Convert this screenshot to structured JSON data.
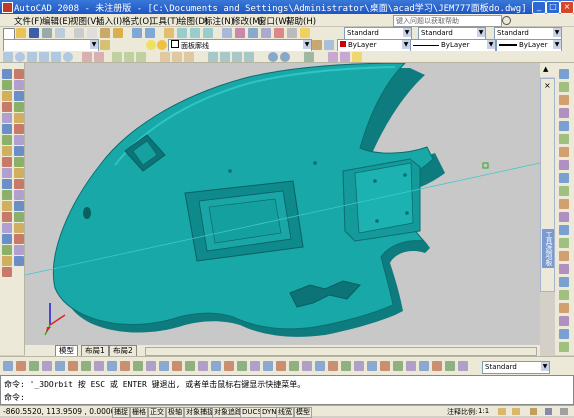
{
  "window": {
    "title": "AutoCAD 2008 - 未注册版 - [C:\\Documents and Settings\\Administrator\\桌面\\acad学习\\JEM777面板do.dwg]"
  },
  "menu": {
    "items": [
      "文件(F)",
      "编辑(E)",
      "视图(V)",
      "插入(I)",
      "格式(O)",
      "工具(T)",
      "绘图(D)",
      "标注(N)",
      "修改(M)",
      "窗口(W)",
      "帮助(H)"
    ],
    "search_placeholder": "键入问题以获取帮助"
  },
  "toolbars": {
    "style_combo1": "Standard",
    "style_combo2": "Standard",
    "style_combo3": "Standard",
    "layer_combo": "面板廓线",
    "color_combo": "ByLayer",
    "linetype_combo": "ByLayer",
    "lineweight_combo": "ByLayer",
    "bottom_combo": "Standard"
  },
  "palette": {
    "label": "工具选项板"
  },
  "tabs": [
    "模型",
    "布局1",
    "布局2"
  ],
  "command": {
    "line1": "命令: '_3DOrbit 按 ESC 或 ENTER 键退出, 或者单击鼠标右键显示快捷菜单。",
    "line2": "命令:"
  },
  "status": {
    "coords": "-860.5520, 113.9509 , 0.0000",
    "buttons": [
      "捕捉",
      "栅格",
      "正交",
      "极轴",
      "对象捕捉",
      "对象追踪",
      "DUCS",
      "DYN",
      "线宽",
      "模型"
    ],
    "annotation_scale_label": "注释比例:",
    "annotation_scale": "1:1"
  },
  "colors": {
    "model_fill": "#18a8a8",
    "model_dark": "#0e7c7e",
    "model_light": "#2fc4c4",
    "background": "#c8c8c8",
    "axis_line": "#40c8c8",
    "titlebar": "#2a64d0"
  }
}
